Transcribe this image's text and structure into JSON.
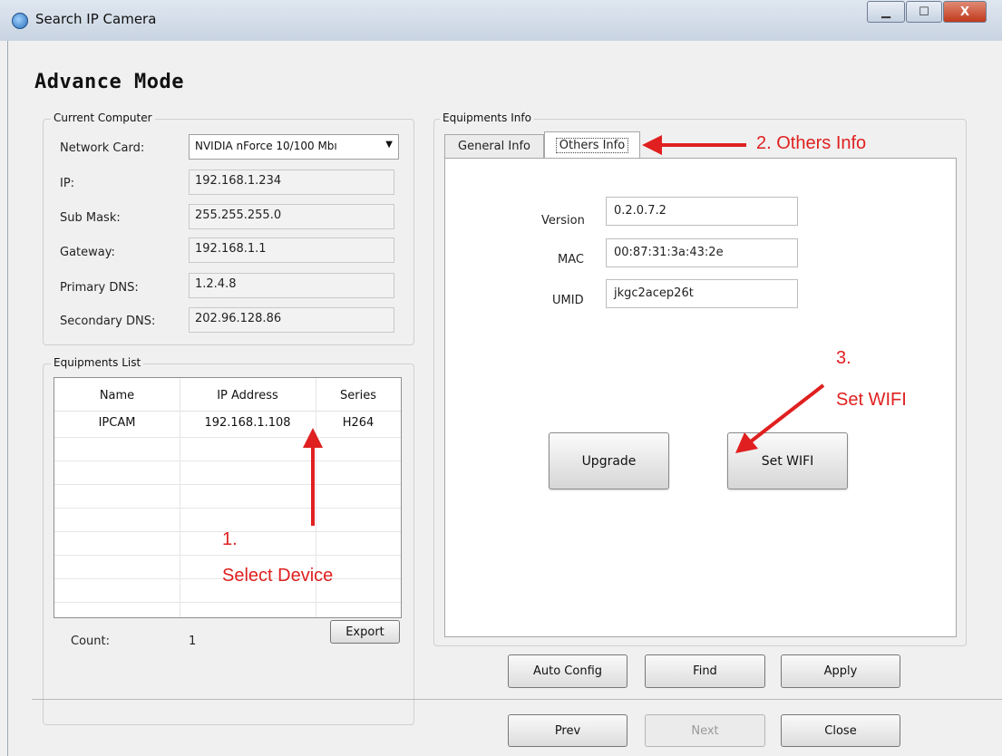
{
  "window": {
    "title": "Search IP Camera",
    "minimize": "▁",
    "maximize": "☐",
    "close": "X"
  },
  "heading": "Advance Mode",
  "current_computer": {
    "legend": "Current Computer",
    "network_card": {
      "label": "Network Card:",
      "value": "NVIDIA nForce 10/100 Mbı"
    },
    "ip": {
      "label": "IP:",
      "value": "192.168.1.234"
    },
    "sub_mask": {
      "label": "Sub Mask:",
      "value": "255.255.255.0"
    },
    "gateway": {
      "label": "Gateway:",
      "value": "192.168.1.1"
    },
    "primary_dns": {
      "label": "Primary DNS:",
      "value": "1.2.4.8"
    },
    "secondary_dns": {
      "label": "Secondary DNS:",
      "value": "202.96.128.86"
    }
  },
  "equipments_list": {
    "legend": "Equipments List",
    "columns": [
      "Name",
      "IP Address",
      "Series"
    ],
    "rows": [
      [
        "IPCAM",
        "192.168.1.108",
        "H264"
      ]
    ],
    "count_label": "Count:",
    "count_value": "1",
    "export_label": "Export"
  },
  "equipments_info": {
    "legend": "Equipments Info",
    "tabs": [
      "General Info",
      "Others Info"
    ],
    "active_tab": "Others Info",
    "version": {
      "label": "Version",
      "value": "0.2.0.7.2"
    },
    "mac": {
      "label": "MAC",
      "value": "00:87:31:3a:43:2e"
    },
    "umid": {
      "label": "UMID",
      "value": "jkgc2acep26t"
    },
    "upgrade_label": "Upgrade",
    "set_wifi_label": "Set WIFI"
  },
  "actions": {
    "auto_config": "Auto Config",
    "find": "Find",
    "apply": "Apply"
  },
  "nav": {
    "prev": "Prev",
    "next": "Next",
    "close": "Close"
  },
  "annotations": {
    "step1_num": "1.",
    "step1_text": "Select Device",
    "step2": "2. Others Info",
    "step3_num": "3.",
    "step3_text": "Set WIFI",
    "color": "#e02020"
  }
}
